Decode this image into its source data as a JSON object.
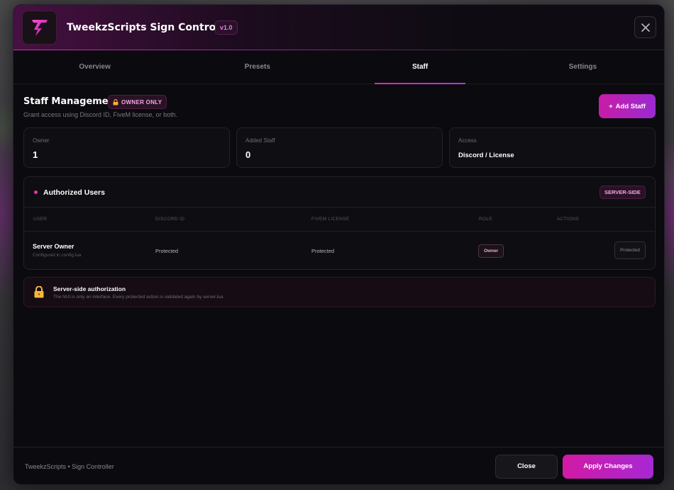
{
  "app": {
    "title": "TweekzScripts Sign Controller",
    "version": "v1.0",
    "logo_icon": "lightning-t-logo"
  },
  "tabs": [
    {
      "label": "Overview",
      "active": false
    },
    {
      "label": "Presets",
      "active": false
    },
    {
      "label": "Staff",
      "active": true
    },
    {
      "label": "Settings",
      "active": false
    }
  ],
  "staff": {
    "title": "Staff Management",
    "badge": "OWNER ONLY",
    "subtitle": "Grant access using Discord ID, FiveM license, or both.",
    "add_button": "Add Staff",
    "add_icon": "+"
  },
  "stats": [
    {
      "label": "Owner",
      "value": "1"
    },
    {
      "label": "Added Staff",
      "value": "0"
    },
    {
      "label": "Access",
      "value": "Discord / License"
    }
  ],
  "users_panel": {
    "title": "Authorized Users",
    "badge": "SERVER-SIDE",
    "columns": [
      "USER",
      "DISCORD ID",
      "FIVEM LICENSE",
      "ROLE",
      "ACTIONS"
    ],
    "rows": [
      {
        "name": "Server Owner",
        "sub": "Configured in config.lua",
        "discord": "Protected",
        "license": "Protected",
        "role": "Owner",
        "action": "Protected"
      }
    ]
  },
  "notice": {
    "title": "Server-side authorization",
    "text": "The NUI is only an interface. Every protected action is validated again by server.lua."
  },
  "footer": {
    "text": "TweekzScripts • Sign Controller",
    "close_label": "Close",
    "apply_label": "Apply Changes"
  },
  "colors": {
    "accent": "#d21aa4",
    "accent2": "#a728d3",
    "background": "#0b0a0e"
  }
}
